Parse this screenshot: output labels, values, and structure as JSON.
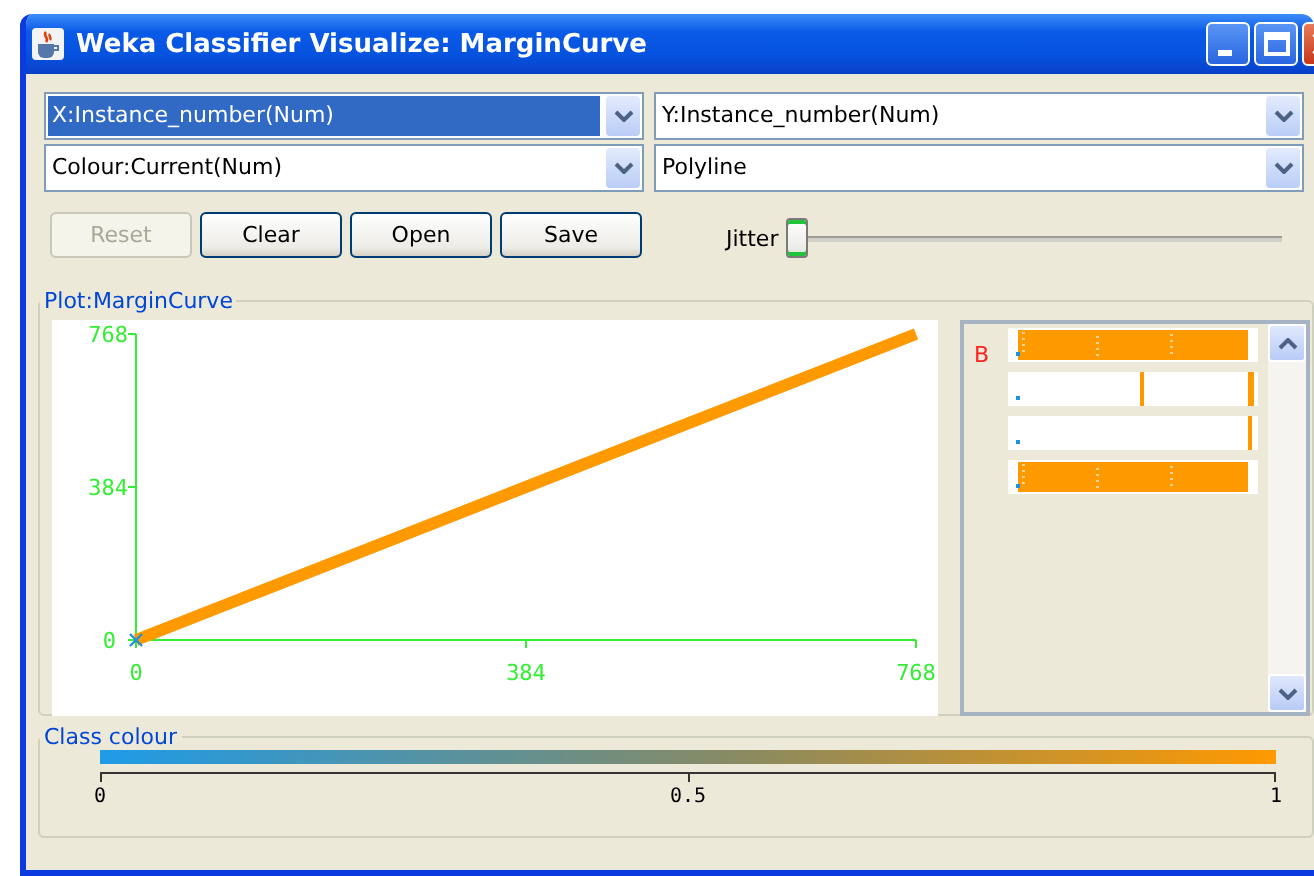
{
  "window": {
    "title": "Weka Classifier Visualize: MarginCurve"
  },
  "selectors": [
    {
      "value": "X:Instance_number(Num)",
      "focused": true
    },
    {
      "value": "Y:Instance_number(Num)",
      "focused": false
    },
    {
      "value": "Colour:Current(Num)",
      "focused": false
    },
    {
      "value": "Polyline",
      "focused": false
    }
  ],
  "buttons": [
    {
      "label": "Reset",
      "disabled": true
    },
    {
      "label": "Clear",
      "disabled": false
    },
    {
      "label": "Open",
      "disabled": false
    },
    {
      "label": "Save",
      "disabled": false
    }
  ],
  "jitter": {
    "label": "Jitter",
    "level": 0
  },
  "plot": {
    "title": "Plot:MarginCurve",
    "chart_data": {
      "type": "line",
      "x": [
        0,
        768
      ],
      "series": [
        {
          "color": "#ff9900",
          "values": [
            0,
            768
          ]
        }
      ],
      "xlim": [
        0,
        768
      ],
      "ylim": [
        0,
        768
      ],
      "xticks": [
        0,
        384,
        768
      ],
      "yticks": [
        0,
        384,
        768
      ]
    },
    "legend_label": "B"
  },
  "class_colour": {
    "title": "Class colour",
    "ticks": [
      "0",
      "0.5",
      "1"
    ]
  }
}
